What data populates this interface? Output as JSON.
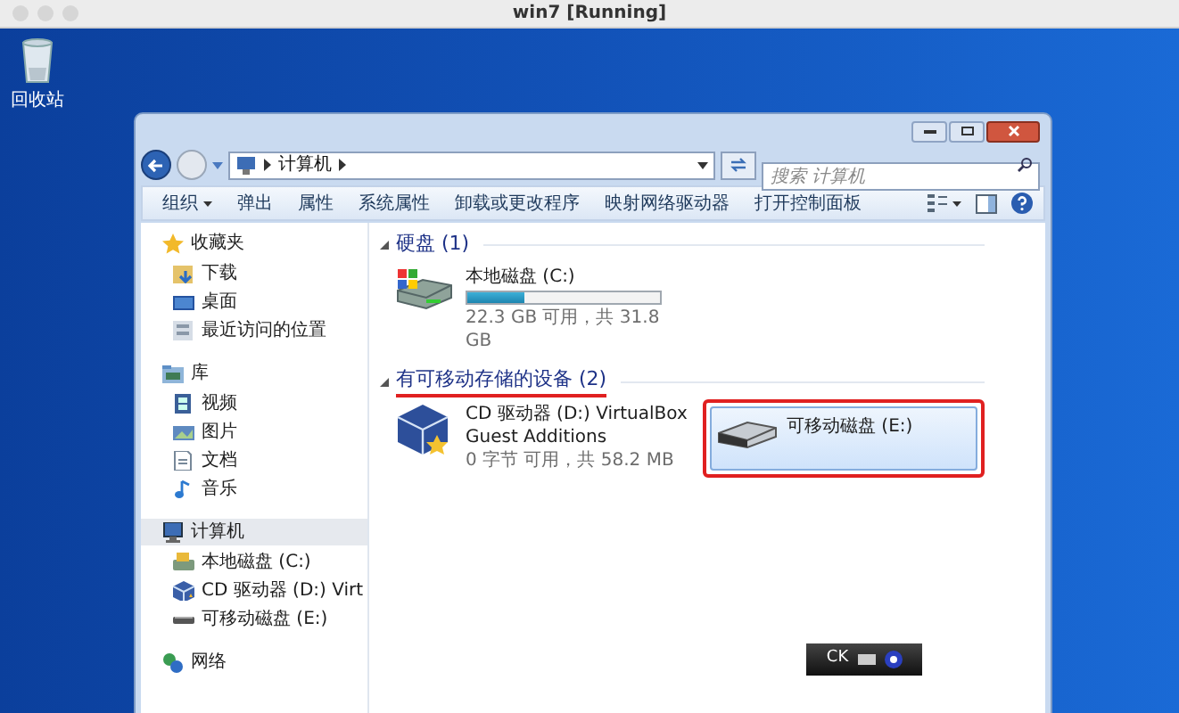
{
  "host_window": {
    "title": "win7 [Running]"
  },
  "desktop_icons": [
    {
      "label": "回收站"
    }
  ],
  "explorer": {
    "address": {
      "path": [
        "计算机"
      ]
    },
    "search": {
      "placeholder": "搜索 计算机"
    },
    "toolbar": [
      {
        "label": "组织",
        "kind": "menu"
      },
      {
        "label": "弹出",
        "kind": "command"
      },
      {
        "label": "属性",
        "kind": "command"
      },
      {
        "label": "系统属性",
        "kind": "command"
      },
      {
        "label": "卸载或更改程序",
        "kind": "command"
      },
      {
        "label": "映射网络驱动器",
        "kind": "command"
      },
      {
        "label": "打开控制面板",
        "kind": "command"
      }
    ],
    "sidebar": [
      {
        "label": "收藏夹",
        "selected": false,
        "children": [
          {
            "label": "下载"
          },
          {
            "label": "桌面"
          },
          {
            "label": "最近访问的位置"
          }
        ]
      },
      {
        "label": "库",
        "selected": false,
        "children": [
          {
            "label": "视频"
          },
          {
            "label": "图片"
          },
          {
            "label": "文档"
          },
          {
            "label": "音乐"
          }
        ]
      },
      {
        "label": "计算机",
        "selected": true,
        "children": [
          {
            "label": "本地磁盘 (C:)"
          },
          {
            "label": "CD 驱动器 (D:) Virt"
          },
          {
            "label": "可移动磁盘 (E:)"
          }
        ]
      },
      {
        "label": "网络",
        "selected": false
      }
    ],
    "sections": [
      {
        "title": "硬盘",
        "count": "(1)",
        "annotated": false,
        "items": [
          {
            "kind": "disk",
            "name": "本地磁盘 (C:)",
            "level": 0.3,
            "detail": "22.3 GB 可用，共 31.8 GB",
            "selected": false,
            "annotated": false
          }
        ]
      },
      {
        "title": "有可移动存储的设备",
        "count": "(2)",
        "annotated": true,
        "items": [
          {
            "kind": "cd",
            "name": "CD 驱动器 (D:) VirtualBox Guest Additions",
            "detail": "0 字节 可用，共 58.2 MB",
            "selected": false,
            "annotated": false
          },
          {
            "kind": "removable",
            "name": "可移动磁盘 (E:)",
            "selected": true,
            "annotated": true
          }
        ]
      }
    ]
  },
  "vm_indicator": {
    "label": "CK"
  }
}
